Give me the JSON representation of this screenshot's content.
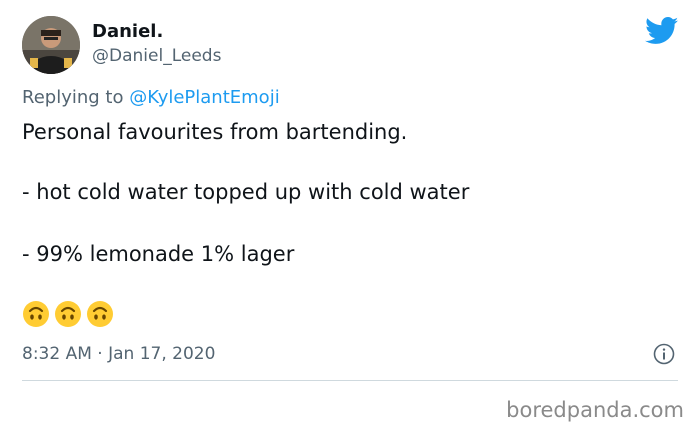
{
  "tweet": {
    "author": {
      "display_name": "Daniel.",
      "handle": "@Daniel_Leeds"
    },
    "reply": {
      "prefix": "Replying to ",
      "mention": "@KylePlantEmoji"
    },
    "lines": [
      "Personal favourites from bartending.",
      "- hot cold water topped up with cold water",
      "- 99% lemonade 1% lager"
    ],
    "emojis": [
      "upside-down-face-icon",
      "upside-down-face-icon",
      "upside-down-face-icon"
    ],
    "timestamp": "8:32 AM · Jan 17, 2020"
  },
  "watermark": "boredpanda.com",
  "colors": {
    "twitter_blue": "#1d9bf0",
    "secondary_text": "#536471",
    "emoji_yellow": "#ffcc33"
  }
}
